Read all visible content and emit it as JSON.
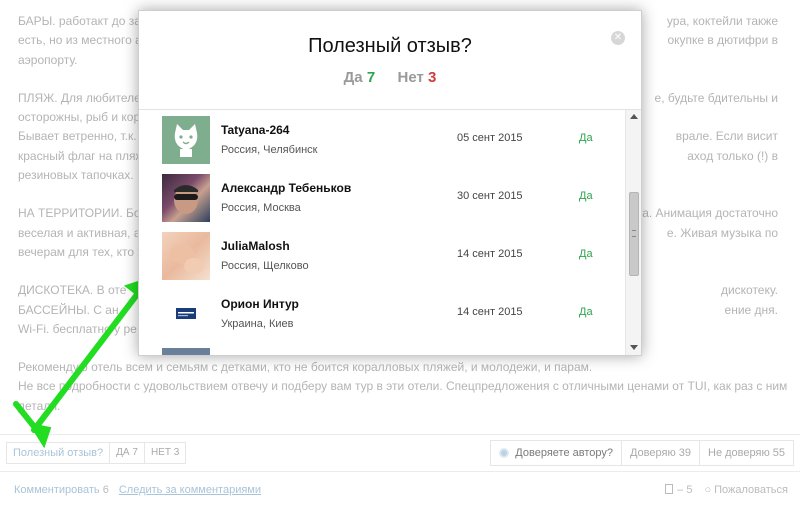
{
  "article": {
    "lines": [
      [
        "БАРЫ. работакт до за",
        "ура, коктейли также"
      ],
      [
        "есть, но из местного а",
        "окупке в дютифри в"
      ],
      [
        "аэропорту.",
        ""
      ],
      [
        "ПЛЯЖ. Для любителей",
        "е, будьте бдительны и"
      ],
      [
        "осторожны, рыб и кор",
        ""
      ],
      [
        "Бывает ветренно, т.к.",
        "врале. Если висит"
      ],
      [
        "красный флаг на пляж",
        "аход только (!) в"
      ],
      [
        "резиновых тапочках.",
        ""
      ],
      [
        "НА ТЕРРИТОРИИ. Боч",
        "а. Анимация достаточно"
      ],
      [
        "веселая и активная, а",
        "е. Живая музыка по"
      ],
      [
        "вечерам для тех, кто х",
        ""
      ],
      [
        "ДИСКОТЕКА. В оте",
        "дискотеку."
      ],
      [
        "БАССЕЙНЫ. С ан",
        "ение дня."
      ],
      [
        "Wi-Fi. бесплатно у ре",
        ""
      ],
      [
        "Рекомендую отель всем и семьям с детками, кто не боится коралловых пляжей, и молодежи, и парам.",
        ""
      ],
      [
        "Не все подробности с удовольствием отвечу и подберу вам тур в эти отели. Спецпредложения с отличными ценами от TUI, как раз с ними и",
        ""
      ],
      [
        "детали.",
        ""
      ]
    ]
  },
  "useful": {
    "label": "Полезный отзыв?",
    "yes": "ДА 7",
    "no": "НЕТ 3"
  },
  "trust": {
    "question": "Доверяете автору?",
    "trust": "Доверяю 39",
    "distrust": "Не доверяю 55"
  },
  "comments": {
    "label": "Комментировать",
    "count": "6",
    "follow": "Следить за комментариями"
  },
  "actions": {
    "delete": "– 5",
    "complain": "○ Пожаловаться"
  },
  "modal": {
    "title": "Полезный отзыв?",
    "yes_label": "Да",
    "yes_count": "7",
    "no_label": "Нет",
    "no_count": "3",
    "close": "✕",
    "voters": [
      {
        "name": "Tatyana-264",
        "location": "Россия, Челябинск",
        "date": "05 сент 2015",
        "vote": "Да",
        "avatar": "cat-avatar"
      },
      {
        "name": "Александр Тебеньков",
        "location": "Россия, Москва",
        "date": "30 сент 2015",
        "vote": "Да",
        "avatar": "photo-avatar"
      },
      {
        "name": "JuliaMalosh",
        "location": "Россия, Щелково",
        "date": "14 сент 2015",
        "vote": "Да",
        "avatar": "baby-photo-avatar"
      },
      {
        "name": "Орион Интур",
        "location": "Украина, Киев",
        "date": "14 сент 2015",
        "vote": "Да",
        "avatar": "logo-avatar"
      }
    ]
  },
  "colors": {
    "yes": "#2ea44f",
    "no": "#d23c3c",
    "arrow": "#22dd22"
  }
}
